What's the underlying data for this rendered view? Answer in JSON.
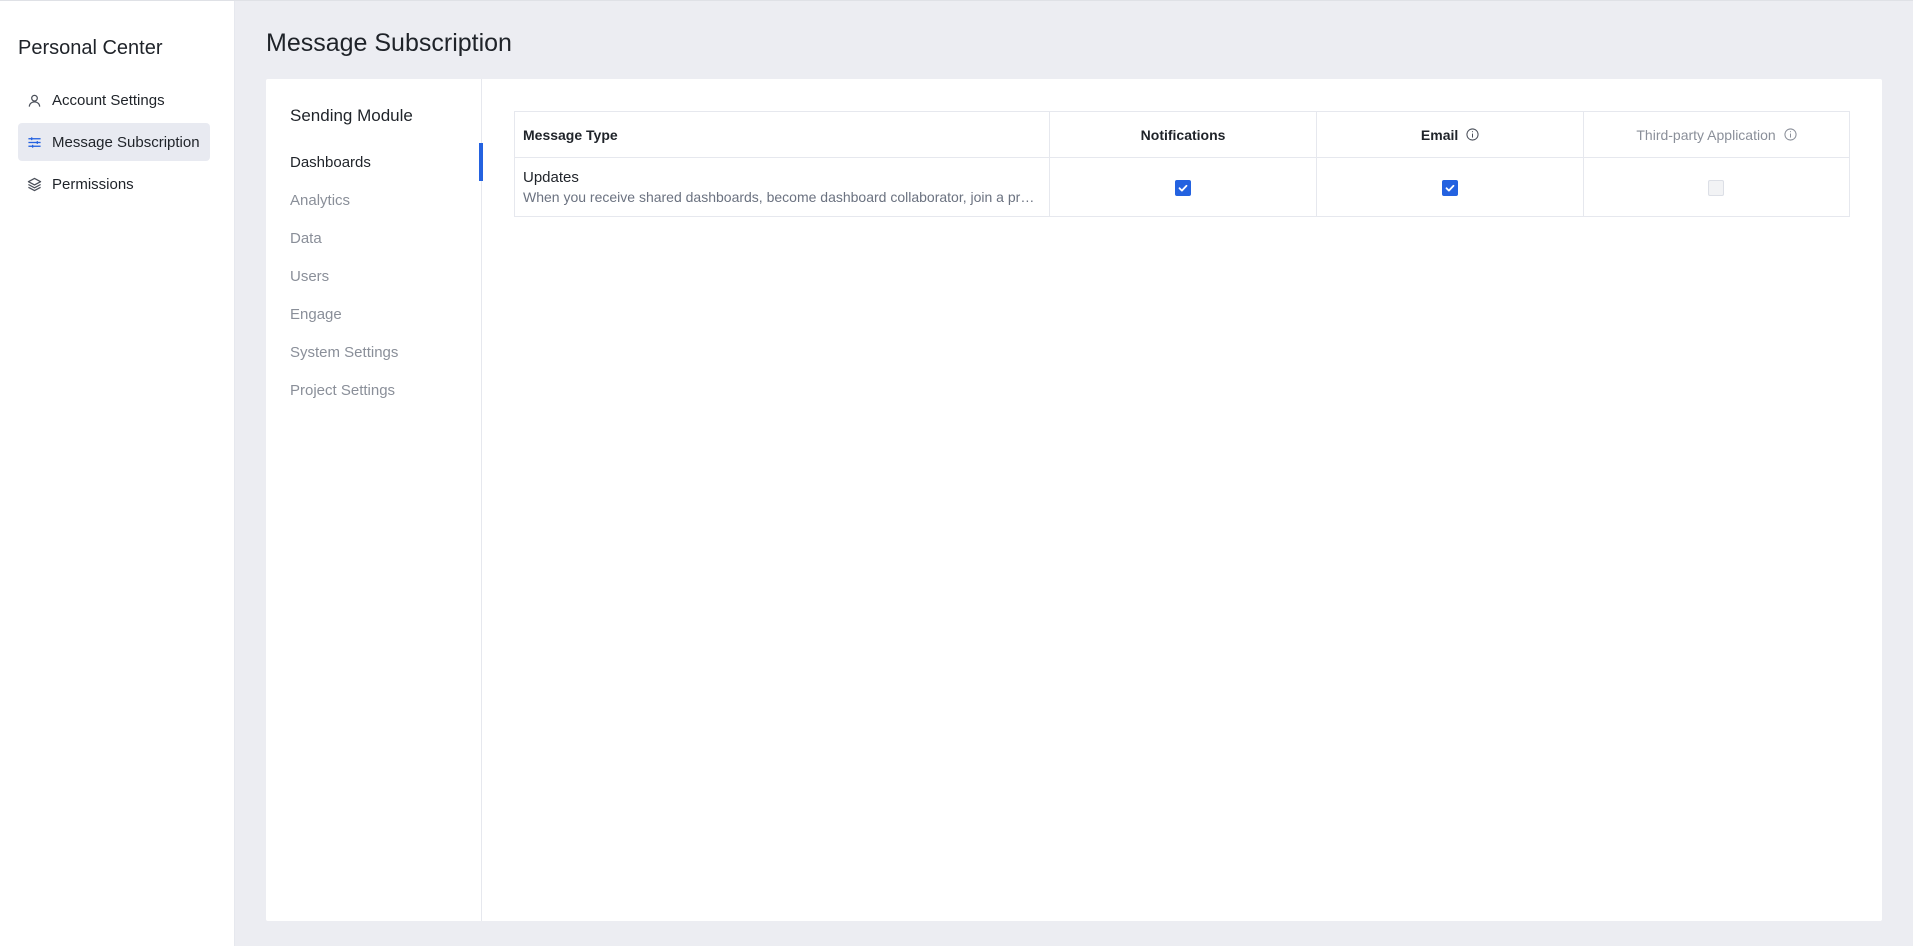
{
  "sidebar": {
    "title": "Personal Center",
    "items": [
      {
        "label": "Account Settings",
        "icon": "user-icon",
        "active": false
      },
      {
        "label": "Message Subscription",
        "icon": "sliders-icon",
        "active": true
      },
      {
        "label": "Permissions",
        "icon": "layers-icon",
        "active": false
      }
    ]
  },
  "page": {
    "title": "Message Subscription"
  },
  "module_nav": {
    "title": "Sending Module",
    "items": [
      {
        "label": "Dashboards",
        "active": true
      },
      {
        "label": "Analytics",
        "active": false
      },
      {
        "label": "Data",
        "active": false
      },
      {
        "label": "Users",
        "active": false
      },
      {
        "label": "Engage",
        "active": false
      },
      {
        "label": "System Settings",
        "active": false
      },
      {
        "label": "Project Settings",
        "active": false
      }
    ]
  },
  "table": {
    "headers": {
      "message_type": "Message Type",
      "notifications": "Notifications",
      "email": "Email",
      "third_party": "Third-party Application"
    },
    "rows": [
      {
        "title": "Updates",
        "description": "When you receive shared dashboards, become dashboard collaborator, join a project, or dashboards you follow are updated",
        "notifications": true,
        "email": true,
        "third_party": false,
        "third_party_disabled": true
      }
    ]
  },
  "colors": {
    "accent": "#2462e0",
    "background": "#ecedf2",
    "active_item": "#e8eaf1"
  }
}
